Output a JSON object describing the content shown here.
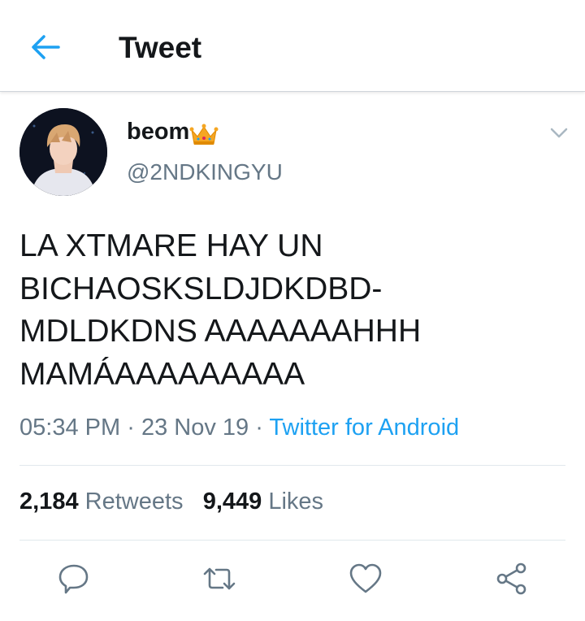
{
  "header": {
    "title": "Tweet",
    "back_icon": "arrow-left-icon",
    "accent": "#1da1f2"
  },
  "user": {
    "display_name": "beom",
    "display_emoji": "crown-icon",
    "handle": "@2NDKINGYU",
    "avatar": "profile-photo"
  },
  "tweet": {
    "text_lines": [
      "LA XTMARE HAY UN",
      "BICHAOSKSLDJDKDBD-",
      "MDLDKDNS AAAAAAAHHH",
      "MAMÁAAAAAAAAA"
    ],
    "time": "05:34 PM",
    "date": "23 Nov 19",
    "separator": "·",
    "source": "Twitter for Android"
  },
  "stats": {
    "retweets_count": "2,184",
    "retweets_label": "Retweets",
    "likes_count": "9,449",
    "likes_label": "Likes"
  },
  "actions": [
    "reply-icon",
    "retweet-icon",
    "like-icon",
    "share-icon"
  ]
}
